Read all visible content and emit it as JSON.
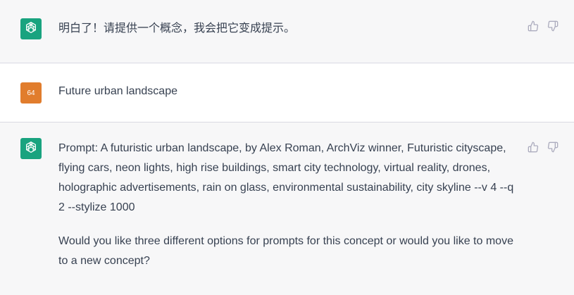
{
  "messages": [
    {
      "role": "assistant",
      "avatar_icon": "openai-logo-icon",
      "paragraphs": [
        "明白了！请提供一个概念，我会把它变成提示。"
      ]
    },
    {
      "role": "user",
      "avatar_text": "64",
      "paragraphs": [
        "Future urban landscape"
      ]
    },
    {
      "role": "assistant",
      "avatar_icon": "openai-logo-icon",
      "paragraphs": [
        "Prompt: A futuristic urban landscape, by Alex Roman, ArchViz winner, Futuristic cityscape, flying cars, neon lights, high rise buildings, smart city technology, virtual reality, drones, holographic advertisements, rain on glass, environmental sustainability, city skyline --v 4 --q 2 --stylize 1000",
        "Would you like three different options for prompts for this concept or would you like to move to a new concept?"
      ]
    }
  ],
  "feedback_icons": [
    "thumbs-up-icon",
    "thumbs-down-icon"
  ],
  "colors": {
    "assistant_avatar": "#19a37f",
    "user_avatar": "#e17d2d",
    "assistant_bg": "#f7f7f8",
    "user_bg": "#ffffff",
    "text": "#374151",
    "icon": "#acacbe"
  }
}
